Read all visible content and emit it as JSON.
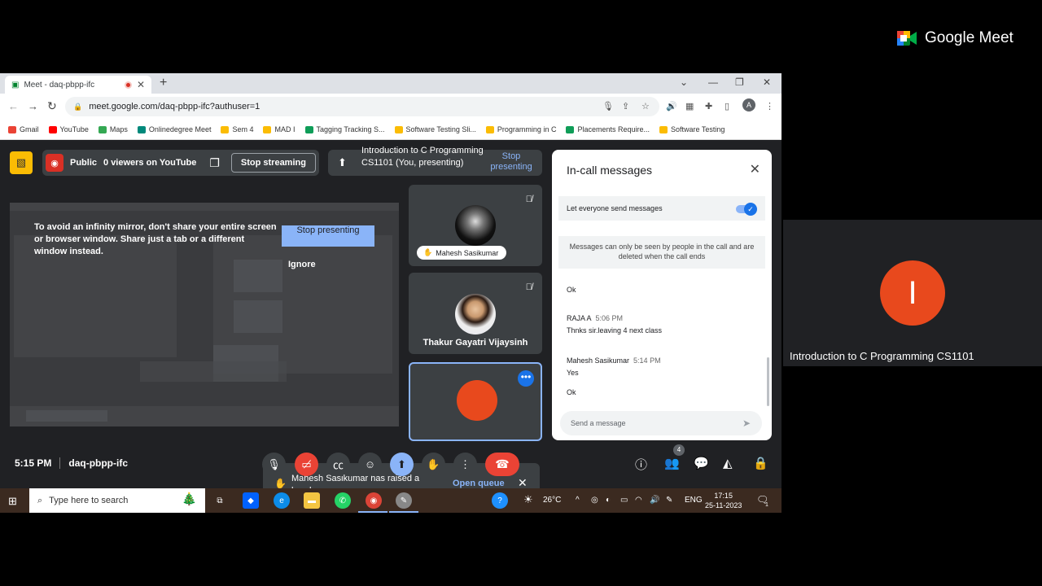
{
  "logo": {
    "text": "Google Meet"
  },
  "right_tile": {
    "avatar_letter": "I",
    "name": "Introduction to C Programming CS1101"
  },
  "browser": {
    "tab_title": "Meet - daq-pbpp-ifc",
    "url": "meet.google.com/daq-pbpp-ifc?authuser=1",
    "profile_letter": "A",
    "bookmarks": [
      {
        "label": "Gmail",
        "color": "#ea4335"
      },
      {
        "label": "YouTube",
        "color": "#ff0000"
      },
      {
        "label": "Maps",
        "color": "#34a853"
      },
      {
        "label": "Onlinedegree Meet",
        "color": "#00897b"
      },
      {
        "label": "Sem 4",
        "color": "#fbbc04"
      },
      {
        "label": "MAD I",
        "color": "#fbbc04"
      },
      {
        "label": "Tagging Tracking S...",
        "color": "#0f9d58"
      },
      {
        "label": "Software Testing Sli...",
        "color": "#fbbc04"
      },
      {
        "label": "Programming in C",
        "color": "#fbbc04"
      },
      {
        "label": "Placements Require...",
        "color": "#0f9d58"
      },
      {
        "label": "Software Testing",
        "color": "#fbbc04"
      }
    ]
  },
  "stream": {
    "visibility": "Public",
    "viewers": "0 viewers on YouTube",
    "stop_label": "Stop streaming"
  },
  "presenting": {
    "title": "Introduction to C Programming CS1101 (You, presenting)",
    "stop_label": "Stop presenting"
  },
  "screen_share": {
    "warning": "To avoid an infinity mirror, don't share your entire screen or browser window. Share just a tab or a different window instead.",
    "stop_label": "Stop presenting",
    "ignore_label": "Ignore"
  },
  "participants": [
    {
      "name": "Mahesh Sasikumar"
    },
    {
      "name": "Thakur Gayatri Vijaysinh"
    }
  ],
  "toast": {
    "message": "Mahesh Sasikumar has raised a hand",
    "action": "Open queue"
  },
  "chat": {
    "title": "In-call messages",
    "toggle_label": "Let everyone send messages",
    "toggle_on": true,
    "notice": "Messages can only be seen by people in the call and are deleted when the call ends",
    "messages": [
      {
        "sender": "",
        "time": "",
        "text": "Ok"
      },
      {
        "sender": "RAJA A",
        "time": "5:06 PM",
        "text": "Thnks sir.leaving 4 next class"
      },
      {
        "sender": "Mahesh Sasikumar",
        "time": "5:14 PM",
        "text": "Yes"
      },
      {
        "sender": "",
        "time": "",
        "text": "Ok"
      }
    ],
    "input_placeholder": "Send a message"
  },
  "bottom": {
    "time": "5:15 PM",
    "meeting_code": "daq-pbpp-ifc",
    "people_count": "4"
  },
  "taskbar": {
    "search_placeholder": "Type here to search",
    "weather": "26°C",
    "language": "ENG",
    "time": "17:15",
    "date": "25-11-2023",
    "notifications": "1"
  },
  "colors": {
    "meet_bg": "#202124",
    "accent_blue": "#8ab4f8",
    "red": "#ea4335",
    "avatar_orange": "#e8491d"
  }
}
